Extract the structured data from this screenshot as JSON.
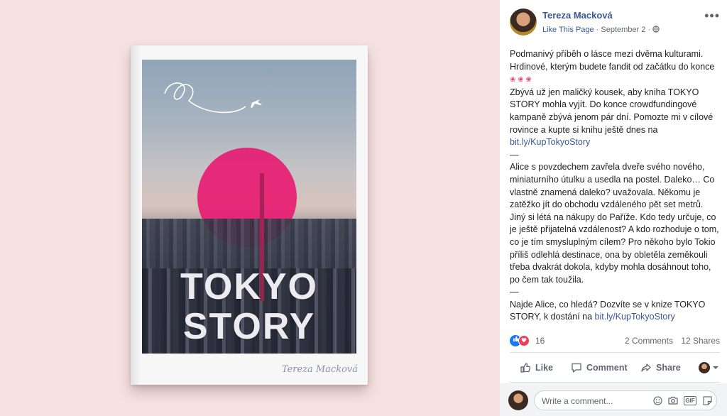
{
  "book": {
    "title_line1": "TOKYO",
    "title_line2": "STORY",
    "author": "Tereza Macková"
  },
  "post": {
    "author_name": "Tereza Macková",
    "like_page": "Like This Page",
    "separator": "·",
    "date": "September 2",
    "separator2": "·",
    "more_label": "•••",
    "text": {
      "p1_a": "Podmanivý příběh o lásce mezi dvěma kulturami. Hrdinové, kterým budete fandit od začátku do konce",
      "p1_emoji": "❀ ❀ ❀",
      "p2": "Zbývá už jen maličký kousek, aby kniha TOKYO STORY mohla vyjít. Do konce crowdfundingové kampaně zbývá jenom pár dní. Pomozte mi v cílové rovince a kupte si knihu ještě dnes na",
      "link1": "bit.ly/KupTokyoStory",
      "dash1": "—",
      "p3": "Alice s povzdechem zavřela dveře svého nového, miniaturního útulku a usedla na postel. Daleko… Co vlastně znamená daleko? uvažovala. Někomu je zatěžko jít do obchodu vzdáleného pět set metrů. Jiný si létá na nákupy do Paříže. Kdo tedy určuje, co je ještě přijatelná vzdálenost? A kdo rozhoduje o tom, co je tím smysluplným cílem? Pro někoho bylo Tokio příliš odlehlá destinace, ona by obletěla zeměkouli třeba dvakrát dokola, kdyby mohla dosáhnout toho, po čem tak toužila.",
      "dash2": "—",
      "p4": "Najde Alice, co hledá? Dozvíte se v knize TOKYO STORY, k dostání na",
      "link2": "bit.ly/KupTokyoStory"
    },
    "reactions": {
      "count": "16",
      "comments": "2 Comments",
      "shares": "12 Shares"
    },
    "actions": {
      "like": "Like",
      "comment": "Comment",
      "share": "Share"
    },
    "comment_box": {
      "placeholder": "Write a comment...",
      "gif_label": "GIF"
    }
  },
  "colors": {
    "background": "#f6e2e2",
    "link": "#385898",
    "sun": "#e8146e"
  }
}
